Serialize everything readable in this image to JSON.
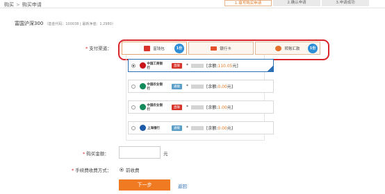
{
  "breadcrumb": {
    "root": "购买",
    "separator": ">",
    "current": "购买申请"
  },
  "steps": [
    {
      "label": "1.填写购买申请",
      "active": true
    },
    {
      "label": "2.确认申请",
      "active": false
    },
    {
      "label": "3.申请成功",
      "active": false
    }
  ],
  "fund": {
    "name": "富国沪深300",
    "meta": "（基金代码：100038 | 最新净值：1.2980）"
  },
  "payment": {
    "label": "支付渠道：",
    "tabs": [
      {
        "label": "富钱包",
        "badge": "1份",
        "icon": "wallet-icon",
        "color": "#d8342c"
      },
      {
        "label": "银行卡",
        "badge": "",
        "icon": "bank-card-icon",
        "color": "#e4522c"
      },
      {
        "label": "转账汇款",
        "badge": "1份",
        "icon": "transfer-icon",
        "color": "#e4722c"
      }
    ]
  },
  "banks": [
    {
      "name": "中国工商银行",
      "tag": "直联",
      "tag_color": "#d8342c",
      "mask": "*",
      "balance_label": "[余额:",
      "balance": "110.05",
      "unit": "元]",
      "selected": true,
      "logo_color": "#c8161d"
    },
    {
      "name": "中国农业银行",
      "tag": "通联",
      "tag_color": "#5b9fc8",
      "mask": "*",
      "balance_label": "[余额:",
      "balance": "0.00",
      "unit": "元]",
      "selected": false,
      "logo_color": "#138a5a"
    },
    {
      "name": "中国农业银行",
      "tag": "直联",
      "tag_color": "#d8342c",
      "mask": "*",
      "balance_label": "[余额:",
      "balance": "1.00",
      "unit": "元]",
      "selected": false,
      "logo_color": "#138a5a"
    },
    {
      "name": "上海银行",
      "tag": "通联",
      "tag_color": "#5b9fc8",
      "mask": "*",
      "balance_label": "[余额:",
      "balance": "0.00",
      "unit": "元]",
      "selected": false,
      "logo_color": "#1d5aa8"
    }
  ],
  "amount": {
    "label": "购买金额：",
    "value": "",
    "unit": "元"
  },
  "fee": {
    "label": "手续费收费方式：",
    "option": "前收费"
  },
  "actions": {
    "next": "下一步",
    "back": "返回"
  }
}
